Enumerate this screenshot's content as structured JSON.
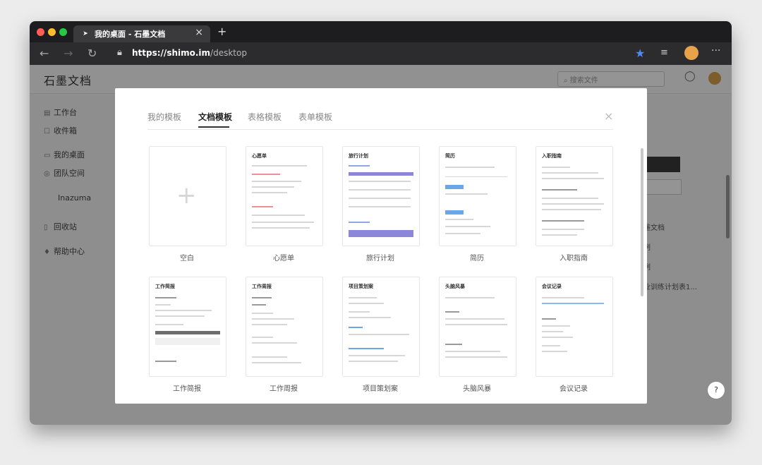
{
  "browser": {
    "tab_title": "我的桌面 - 石墨文档",
    "tab_close": "×",
    "new_tab": "+",
    "url_host": "https://shimo.im",
    "url_path": "/desktop",
    "icons": [
      "back-icon",
      "forward-icon",
      "reload-icon",
      "lock-icon",
      "star-icon",
      "extensions-icon",
      "profile-avatar",
      "more-icon"
    ]
  },
  "app": {
    "logo": "石墨文档",
    "search_placeholder": "搜索文件",
    "sidebar": {
      "items": [
        {
          "label": "工作台",
          "icon": "▤"
        },
        {
          "label": "收件箱",
          "icon": "☐"
        },
        {
          "label": "我的桌面",
          "icon": "▭"
        },
        {
          "label": "团队空间",
          "icon": "◎"
        },
        {
          "label": "Inazuma",
          "icon": ""
        },
        {
          "label": "回收站",
          "icon": "▯"
        },
        {
          "label": "帮助中心",
          "icon": "♦"
        }
      ]
    },
    "background_right": [
      "墨文档",
      "例",
      "例",
      "业训练计划表1..."
    ]
  },
  "modal": {
    "tabs": [
      "我的模板",
      "文档模板",
      "表格模板",
      "表单模板"
    ],
    "active_tab": 1,
    "close": "×",
    "templates": [
      {
        "label": "空白",
        "title": ""
      },
      {
        "label": "心愿单",
        "title": "心愿单"
      },
      {
        "label": "旅行计划",
        "title": "旅行计划"
      },
      {
        "label": "简历",
        "title": "简历"
      },
      {
        "label": "入职指南",
        "title": "入职指南"
      },
      {
        "label": "工作简报",
        "title": "工作简报"
      },
      {
        "label": "工作周报",
        "title": "工作周报"
      },
      {
        "label": "项目策划案",
        "title": "项目策划案"
      },
      {
        "label": "头脑风暴",
        "title": "头脑风暴"
      },
      {
        "label": "会议记录",
        "title": "会议记录"
      }
    ]
  },
  "help_button": "?"
}
